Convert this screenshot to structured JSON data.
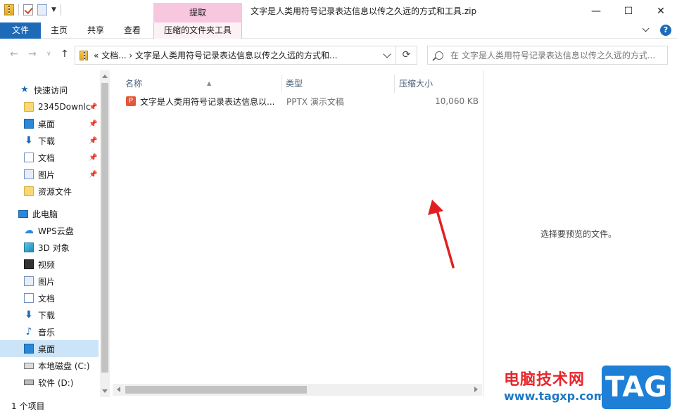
{
  "window": {
    "title": "文字是人类用符号记录表达信息以传之久远的方式和工具.zip",
    "context_tab_group": "提取",
    "controls": {
      "minimize": "—",
      "maximize": "☐",
      "close": "✕"
    }
  },
  "ribbon": {
    "tabs": [
      "文件",
      "主页",
      "共享",
      "查看",
      "压缩的文件夹工具"
    ],
    "help": "?"
  },
  "nav": {
    "address": "«  文档...  ›  文字是人类用符号记录表达信息以传之久远的方式和...",
    "search_placeholder": "在 文字是人类用符号记录表达信息以传之久远的方式..."
  },
  "sidebar": {
    "quick_access": "快速访问",
    "quick_items": [
      {
        "label": "2345Downlc",
        "icon": "folder-icon"
      },
      {
        "label": "桌面",
        "icon": "desktop-icon"
      },
      {
        "label": "下载",
        "icon": "download-icon"
      },
      {
        "label": "文档",
        "icon": "document-icon"
      },
      {
        "label": "图片",
        "icon": "picture-icon"
      },
      {
        "label": "资源文件",
        "icon": "folder-icon"
      }
    ],
    "this_pc": "此电脑",
    "pc_items": [
      {
        "label": "WPS云盘",
        "icon": "cloud-icon"
      },
      {
        "label": "3D 对象",
        "icon": "3d-objects-icon"
      },
      {
        "label": "视频",
        "icon": "video-icon"
      },
      {
        "label": "图片",
        "icon": "picture-icon"
      },
      {
        "label": "文档",
        "icon": "document-icon"
      },
      {
        "label": "下载",
        "icon": "download-icon"
      },
      {
        "label": "音乐",
        "icon": "music-icon"
      },
      {
        "label": "桌面",
        "icon": "desktop-icon",
        "selected": true
      },
      {
        "label": "本地磁盘 (C:)",
        "icon": "local-disk-icon"
      },
      {
        "label": "软件 (D:)",
        "icon": "drive-icon"
      }
    ]
  },
  "columns": [
    "名称",
    "类型",
    "压缩大小"
  ],
  "files": [
    {
      "name": "文字是人类用符号记录表达信息以...",
      "type": "PPTX 演示文稿",
      "size": "10,060 KB",
      "icon": "P"
    }
  ],
  "preview": {
    "message": "选择要预览的文件。"
  },
  "status": {
    "count": "1 个项目"
  },
  "watermark": {
    "title": "电脑技术网",
    "url": "www.tagxp.com",
    "badge": "TAG"
  },
  "colors": {
    "accent": "#1d6bb8",
    "context_tab": "#f7c6df",
    "selected": "#cce4f7",
    "annotation_arrow": "#e02020"
  }
}
